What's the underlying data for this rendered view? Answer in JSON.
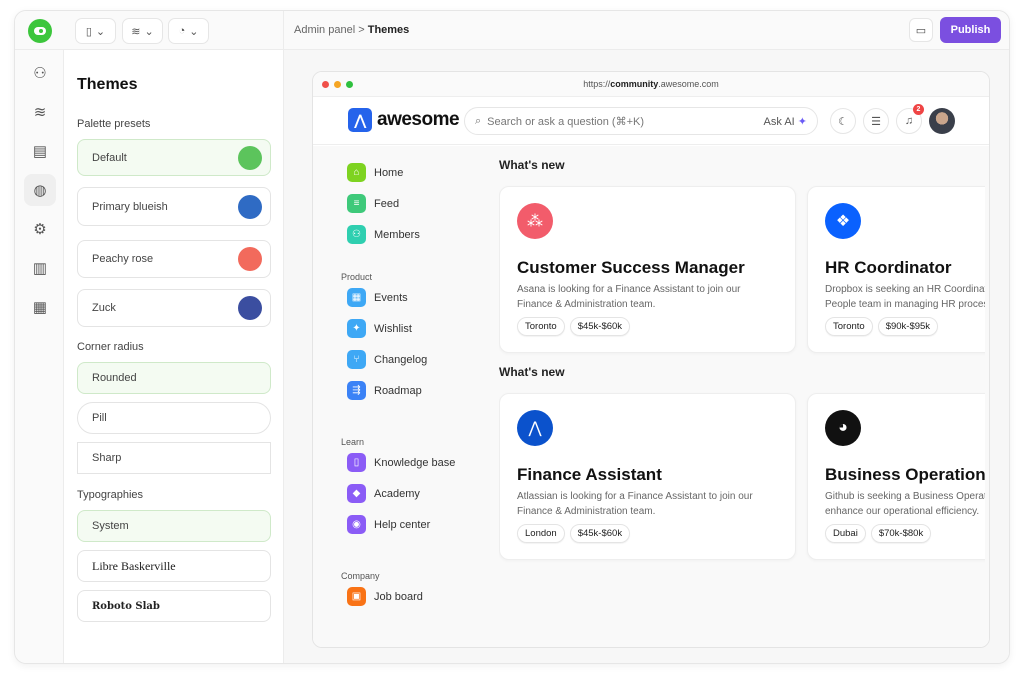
{
  "topbar": {
    "toolbar_buttons": [
      "file-icon",
      "database-icon",
      "chart-pie-icon"
    ],
    "breadcrumb": {
      "parent": "Admin panel",
      "separator": ">",
      "current": "Themes"
    },
    "publish_label": "Publish"
  },
  "rail": [
    "users-icon",
    "database-icon",
    "layout-icon",
    "palette-icon",
    "gear-icon",
    "bar-chart-icon",
    "grid-icon"
  ],
  "panel": {
    "title": "Themes",
    "palette_label": "Palette presets",
    "palettes": [
      {
        "label": "Default",
        "color": "#5cc45c"
      },
      {
        "label": "Primary blueish",
        "color": "#2f6bc4"
      },
      {
        "label": "Peachy rose",
        "color": "#f26a5c"
      },
      {
        "label": "Zuck",
        "color": "#3b4ea0"
      }
    ],
    "radius_label": "Corner radius",
    "radii": [
      "Rounded",
      "Pill",
      "Sharp"
    ],
    "typo_label": "Typographies",
    "typos": [
      "System",
      "Libre Baskerville",
      "Roboto Slab"
    ]
  },
  "browser": {
    "url_prefix": "https://",
    "url_bold": "community",
    "url_suffix": ".awesome.com",
    "brand": "awesome",
    "search_placeholder": "Search or ask a question (⌘+K)",
    "ask_ai": "Ask AI",
    "notif_count": "2",
    "nav": {
      "main": [
        {
          "label": "Home",
          "color": "#7ed321"
        },
        {
          "label": "Feed",
          "color": "#3ec97a"
        },
        {
          "label": "Members",
          "color": "#2fcfb0"
        }
      ],
      "sections": [
        {
          "title": "Product",
          "items": [
            {
              "label": "Events",
              "color": "#3ea8f5"
            },
            {
              "label": "Wishlist",
              "color": "#3ea8f5"
            },
            {
              "label": "Changelog",
              "color": "#3ea8f5"
            },
            {
              "label": "Roadmap",
              "color": "#3b82f6"
            }
          ]
        },
        {
          "title": "Learn",
          "items": [
            {
              "label": "Knowledge base",
              "color": "#8b5cf6"
            },
            {
              "label": "Academy",
              "color": "#8b5cf6"
            },
            {
              "label": "Help center",
              "color": "#8b5cf6"
            }
          ]
        },
        {
          "title": "Company",
          "items": [
            {
              "label": "Job board",
              "color": "#f97316"
            }
          ]
        }
      ]
    },
    "sections": [
      {
        "title": "What's new",
        "cards": [
          {
            "title": "Customer Success Manager",
            "desc1": "Asana is looking for a Finance Assistant to join our",
            "desc2": "Finance & Administration team.",
            "tags": [
              "Toronto",
              "$45k-$60k"
            ],
            "logo": "asana-icon",
            "color": "#f25c6b"
          },
          {
            "title": "HR Coordinator",
            "desc1": "Dropbox is seeking an HR Coordinator to support our",
            "desc2": "People team in managing HR processes.",
            "tags": [
              "Toronto",
              "$90k-$95k"
            ],
            "logo": "dropbox-icon",
            "color": "#0a61fe"
          }
        ]
      },
      {
        "title": "What's new",
        "cards": [
          {
            "title": "Finance Assistant",
            "desc1": "Atlassian is looking for a Finance Assistant to join our",
            "desc2": "Finance & Administration team.",
            "tags": [
              "London",
              "$45k-$60k"
            ],
            "logo": "atlassian-icon",
            "color": "#0b52cc"
          },
          {
            "title": "Business Operations",
            "desc1": "Github is seeking a Business Operations lead to",
            "desc2": "enhance our operational efficiency.",
            "tags": [
              "Dubai",
              "$70k-$80k"
            ],
            "logo": "github-icon",
            "color": "#111111"
          }
        ]
      }
    ]
  }
}
